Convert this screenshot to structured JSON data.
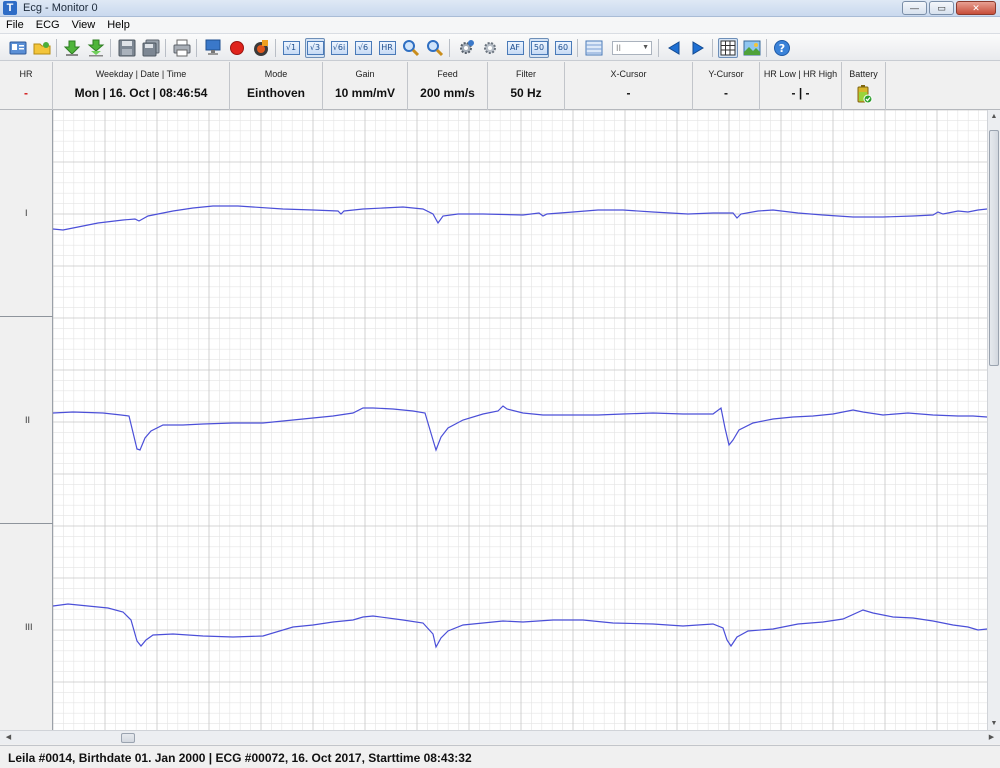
{
  "window": {
    "title": "Ecg - Monitor 0",
    "app_icon_letter": "T",
    "controls": {
      "minimize": "—",
      "maximize": "▭",
      "close": "✕"
    }
  },
  "menu": [
    "File",
    "ECG",
    "View",
    "Help"
  ],
  "toolbar": {
    "boxes": {
      "lead1": "√1",
      "lead3": "√3",
      "lead6i": "√6i",
      "lead6": "√6",
      "hr": "HR",
      "af": "AF",
      "rate50": "50",
      "rate60": "60"
    },
    "layout_select": "II",
    "icons": [
      "open-patient-icon",
      "open-folder-icon",
      "download-icon",
      "download-all-icon",
      "save-icon",
      "save-all-icon",
      "print-icon",
      "monitor-icon",
      "record-icon",
      "stop-record-icon",
      "lead1-icon",
      "lead3-icon",
      "lead6i-icon",
      "lead6-icon",
      "hr-icon",
      "zoom-in-icon",
      "zoom-out-icon",
      "settings-icon",
      "settings-alt-icon",
      "af-icon",
      "rate50-icon",
      "rate60-icon",
      "grid-pattern-icon",
      "layout-select",
      "prev-icon",
      "next-icon",
      "grid-icon",
      "image-icon",
      "help-icon"
    ]
  },
  "info": {
    "hr": {
      "label": "HR",
      "value": "-"
    },
    "datetime": {
      "label": "Weekday | Date | Time",
      "value": "Mon | 16. Oct | 08:46:54"
    },
    "mode": {
      "label": "Mode",
      "value": "Einthoven"
    },
    "gain": {
      "label": "Gain",
      "value": "10 mm/mV"
    },
    "feed": {
      "label": "Feed",
      "value": "200 mm/s"
    },
    "filter": {
      "label": "Filter",
      "value": "50 Hz"
    },
    "xcursor": {
      "label": "X-Cursor",
      "value": "-"
    },
    "ycursor": {
      "label": "Y-Cursor",
      "value": "-"
    },
    "hrrange": {
      "label": "HR Low | HR High",
      "value": "- | -"
    },
    "battery": {
      "label": "Battery"
    }
  },
  "leads": [
    "I",
    "II",
    "III"
  ],
  "colors": {
    "trace": "#4b4fd8",
    "grid_minor": "#e4e4e4",
    "grid_major": "#c6c6c6",
    "hr_value": "#d21b1b"
  },
  "status": "Leila #0014, Birthdate 01. Jan 2000 | ECG #00072, 16. Oct 2017, Starttime 08:43:32"
}
